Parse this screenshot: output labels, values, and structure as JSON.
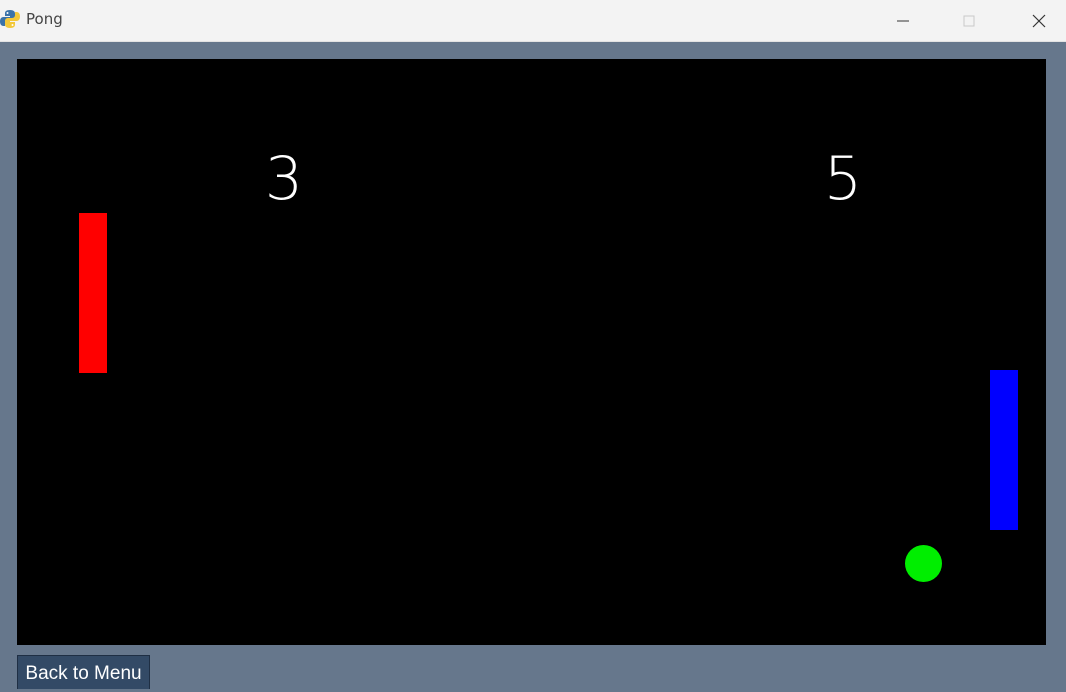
{
  "window": {
    "title": "Pong",
    "icon": "python-icon"
  },
  "game": {
    "score_left": "3",
    "score_right": "5",
    "colors": {
      "background": "#000000",
      "left_paddle": "#ff0000",
      "right_paddle": "#0000ff",
      "ball": "#00ee00",
      "score_text": "#ffffff"
    }
  },
  "footer": {
    "back_label": "Back to Menu"
  },
  "theme": {
    "frame_bg": "#66778c",
    "button_bg": "#334a66"
  }
}
